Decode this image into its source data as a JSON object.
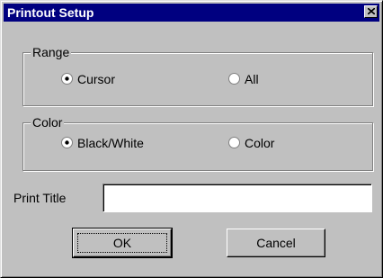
{
  "window": {
    "title": "Printout Setup"
  },
  "range": {
    "label": "Range",
    "options": [
      {
        "label": "Cursor",
        "selected": true
      },
      {
        "label": "All",
        "selected": false
      }
    ]
  },
  "color": {
    "label": "Color",
    "options": [
      {
        "label": "Black/White",
        "selected": true
      },
      {
        "label": "Color",
        "selected": false
      }
    ]
  },
  "print_title": {
    "label": "Print Title",
    "value": ""
  },
  "buttons": {
    "ok": "OK",
    "cancel": "Cancel"
  }
}
